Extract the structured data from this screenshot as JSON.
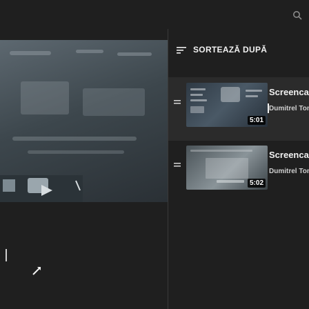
{
  "header": {
    "search_icon": "search-icon"
  },
  "playlist": {
    "sort_icon": "sort-icon",
    "sort_label": "SORTEAZĂ DUPĂ",
    "items": [
      {
        "title": "Screencaptify & Quiz",
        "channel": "Dumitrel Toma",
        "duration": "5:01",
        "now_playing": true
      },
      {
        "title": "Screencaptify & Quiz",
        "channel": "Dumitrel Toma",
        "duration": "5:02",
        "now_playing": false
      }
    ]
  },
  "player": {
    "cursor_icon": "cursor-icon"
  },
  "colors": {
    "background": "#1f1f1f",
    "selected_row": "#2b2b2b",
    "text_primary": "#f1f1f1",
    "text_secondary": "#cfcfcf"
  }
}
